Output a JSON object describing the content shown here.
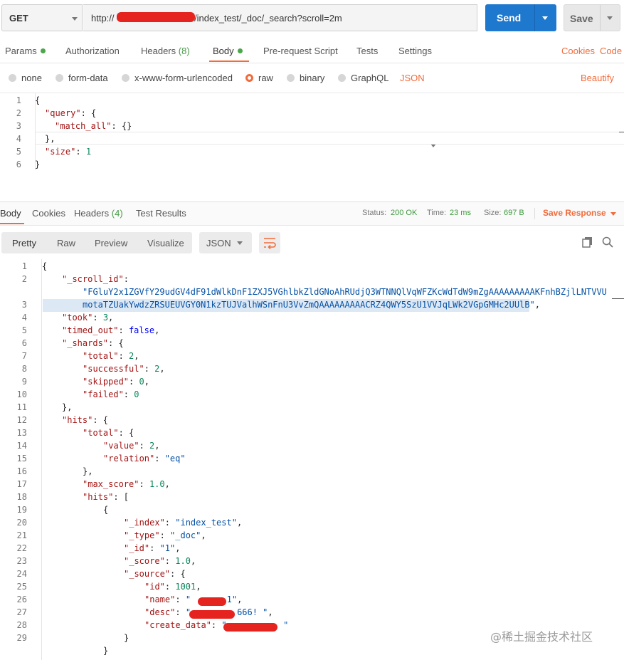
{
  "request": {
    "method": "GET",
    "url_prefix": "http://",
    "url_suffix": "/index_test/_doc/_search?scroll=2m",
    "send_label": "Send",
    "save_label": "Save"
  },
  "request_tabs": [
    {
      "label": "Params",
      "dot": true
    },
    {
      "label": "Authorization"
    },
    {
      "label": "Headers",
      "count": "(8)"
    },
    {
      "label": "Body",
      "dot": true,
      "active": true
    },
    {
      "label": "Pre-request Script"
    },
    {
      "label": "Tests"
    },
    {
      "label": "Settings"
    }
  ],
  "right_links": {
    "cookies": "Cookies",
    "code": "Code"
  },
  "body_types": {
    "none": "none",
    "form_data": "form-data",
    "urlencoded": "x-www-form-urlencoded",
    "raw": "raw",
    "binary": "binary",
    "graphql": "GraphQL",
    "format": "JSON",
    "beautify": "Beautify"
  },
  "request_body": {
    "line_numbers": [
      "1",
      "2",
      "3",
      "4",
      "5",
      "6"
    ],
    "l1": "{",
    "l2_key": "\"query\"",
    "l2_rest": ": {",
    "l3_key": "\"match_all\"",
    "l3_rest": ": {}",
    "l4": "},",
    "l5_key": "\"size\"",
    "l5_colon": ": ",
    "l5_val": "1",
    "l6": "}"
  },
  "response_tabs": {
    "body": "Body",
    "cookies": "Cookies",
    "headers": "Headers",
    "headers_count": "(4)",
    "test_results": "Test Results"
  },
  "status": {
    "status_label": "Status:",
    "status_value": "200 OK",
    "time_label": "Time:",
    "time_value": "23 ms",
    "size_label": "Size:",
    "size_value": "697 B",
    "save_response": "Save Response"
  },
  "view_modes": {
    "pretty": "Pretty",
    "raw": "Raw",
    "preview": "Preview",
    "visualize": "Visualize",
    "format": "JSON"
  },
  "response_body": {
    "line_numbers": [
      "1",
      "2",
      "",
      "3",
      "4",
      "5",
      "6",
      "7",
      "8",
      "9",
      "10",
      "11",
      "12",
      "13",
      "14",
      "15",
      "16",
      "17",
      "18",
      "19",
      "20",
      "21",
      "22",
      "23",
      "24",
      "25",
      "26",
      "27",
      "28",
      "29"
    ],
    "scroll_id_key": "\"_scroll_id\"",
    "scroll_id_1": "\"FGluY2x1ZGVfY29udGV4dF91dWlkDnF1ZXJ5VGhlbkZldGNoAhRUdjQ3WTNNQlVqWFZKcWdTdW9mZgAAAAAAAAAKFnhBZjlLNTVVU",
    "scroll_id_2": "motaTZUakYwdzZRSUEUVGY0N1kzTUJValhWSnFnU3VvZmQAAAAAAAAACRZ4QWY5SzU1VVJqLWk2VGpGMHc2UUlB\"",
    "took": "3",
    "timed_out": "false",
    "shards_total": "2",
    "shards_successful": "2",
    "shards_skipped": "0",
    "shards_failed": "0",
    "hits_total_value": "2",
    "hits_total_relation": "\"eq\"",
    "max_score": "1.0",
    "index": "\"index_test\"",
    "type": "\"_doc\"",
    "id": "\"1\"",
    "score": "1.0",
    "source_id": "1001",
    "name_suffix": "-1\"",
    "desc_suffix": "666! \"",
    "create_suffix": "\""
  },
  "watermark": "@稀土掘金技术社区"
}
